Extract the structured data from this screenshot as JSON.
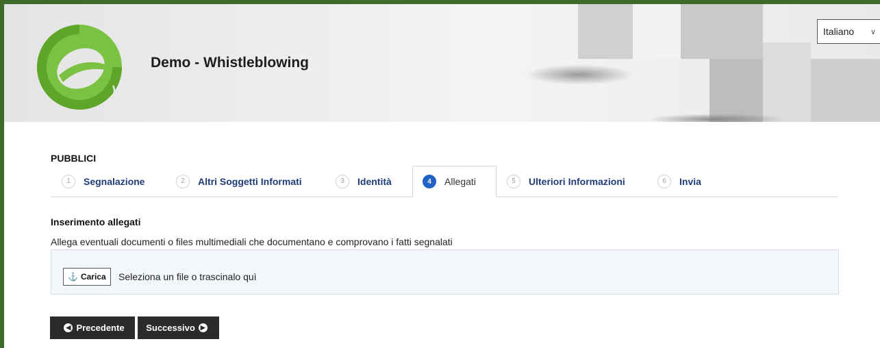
{
  "header": {
    "title": "Demo - Whistleblowing",
    "language": "Italiano"
  },
  "section_title": "PUBBLICI",
  "tabs": [
    {
      "num": "1",
      "label": "Segnalazione"
    },
    {
      "num": "2",
      "label": "Altri Soggetti Informati"
    },
    {
      "num": "3",
      "label": "Identità"
    },
    {
      "num": "4",
      "label": "Allegati"
    },
    {
      "num": "5",
      "label": "Ulteriori Informazioni"
    },
    {
      "num": "6",
      "label": "Invia"
    }
  ],
  "attachments": {
    "heading": "Inserimento allegati",
    "description": "Allega eventuali documenti o files multimediali che documentano e comprovano i fatti segnalati",
    "upload_button": "Carica",
    "upload_hint": "Seleziona un file o trascinalo quì"
  },
  "nav": {
    "prev": "Precedente",
    "next": "Successivo"
  },
  "colors": {
    "brand_green": "#7cc242",
    "tab_blue": "#1f3b76",
    "active_badge": "#1f63c6",
    "frame_green": "#3f6b2a"
  }
}
